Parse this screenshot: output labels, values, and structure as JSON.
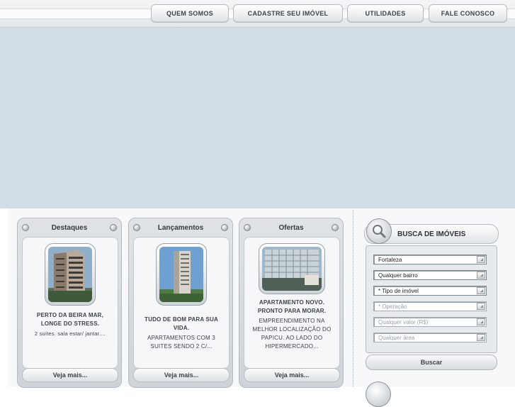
{
  "nav": {
    "items": [
      {
        "label": "QUEM SOMOS"
      },
      {
        "label": "CADASTRE SEU IMÓVEL"
      },
      {
        "label": "UTILIDADES"
      },
      {
        "label": "FALE CONOSCO"
      }
    ]
  },
  "cards": [
    {
      "title": "Destaques",
      "headline": "PERTO DA BEIRA MAR, LONGE DO STRESS.",
      "description": "2 suítes. sala estar/ jantar....",
      "more": "Veja mais..."
    },
    {
      "title": "Lançamentos",
      "headline": "TUDO DE BOM PARA SUA VIDA.",
      "description": "APARTAMENTOS COM 3 SUITES SENDO 2 C/...",
      "more": "Veja mais..."
    },
    {
      "title": "Ofertas",
      "headline": "APARTAMENTO NOVO. PRONTO PARA MORAR.",
      "description": "EMPREENDIMENTO NA MELHOR LOCALIZAÇÃO DO PAPICU. AO LADO DO HIPERMERCADO...",
      "more": "Veja mais..."
    }
  ],
  "search": {
    "title": "BUSCA DE IMÓVEIS",
    "fields": [
      {
        "value": "Fortaleza"
      },
      {
        "value": "Qualquer bairro"
      },
      {
        "value": "* Tipo de imóvel"
      },
      {
        "value": "* Operação"
      },
      {
        "value": "Qualquer valor (R$)"
      },
      {
        "value": "Qualquer área"
      }
    ],
    "button": "Buscar"
  },
  "colors": {
    "banner": "#d3dde5",
    "panel": "#dfe3e6",
    "text": "#3c4248"
  }
}
